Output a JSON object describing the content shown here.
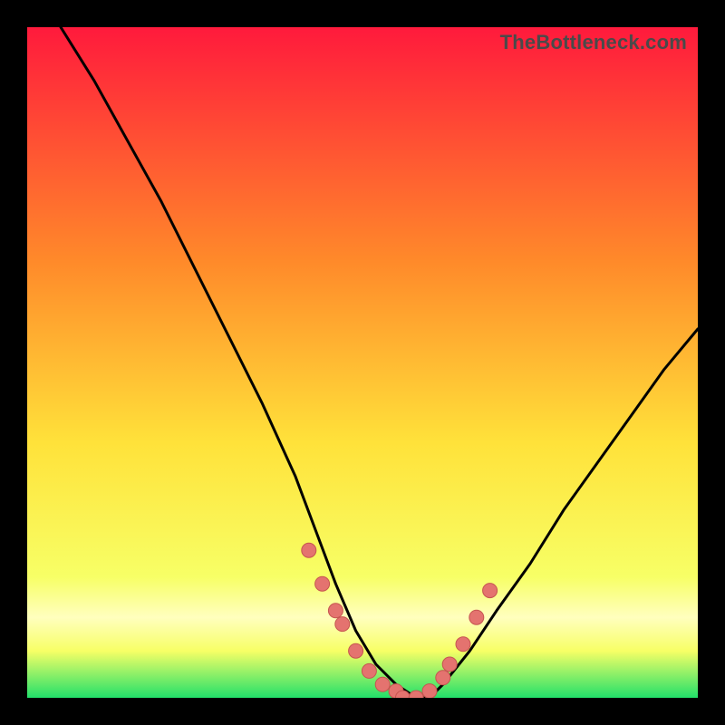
{
  "watermark": "TheBottleneck.com",
  "colors": {
    "gradient_top": "#ff1a3c",
    "gradient_mid1": "#ff8a2a",
    "gradient_mid2": "#ffe23a",
    "gradient_low": "#f7ff66",
    "gradient_band": "#ffffbe",
    "gradient_bottom": "#22e06a",
    "curve": "#000000",
    "points": "#e4736f",
    "points_stroke": "#c65550"
  },
  "chart_data": {
    "type": "line",
    "title": "",
    "xlabel": "",
    "ylabel": "",
    "xlim": [
      0,
      100
    ],
    "ylim": [
      0,
      100
    ],
    "series": [
      {
        "name": "bottleneck-curve",
        "x": [
          5,
          10,
          15,
          20,
          25,
          30,
          35,
          40,
          43,
          46,
          49,
          52,
          55,
          58,
          60,
          62,
          66,
          70,
          75,
          80,
          85,
          90,
          95,
          100
        ],
        "values": [
          100,
          92,
          83,
          74,
          64,
          54,
          44,
          33,
          25,
          17,
          10,
          5,
          2,
          0,
          0,
          2,
          7,
          13,
          20,
          28,
          35,
          42,
          49,
          55
        ]
      }
    ],
    "scatter": {
      "name": "sample-points",
      "x": [
        42,
        44,
        46,
        47,
        49,
        51,
        53,
        55,
        56,
        58,
        60,
        62,
        63,
        65,
        67,
        69
      ],
      "values": [
        22,
        17,
        13,
        11,
        7,
        4,
        2,
        1,
        0,
        0,
        1,
        3,
        5,
        8,
        12,
        16
      ]
    }
  }
}
